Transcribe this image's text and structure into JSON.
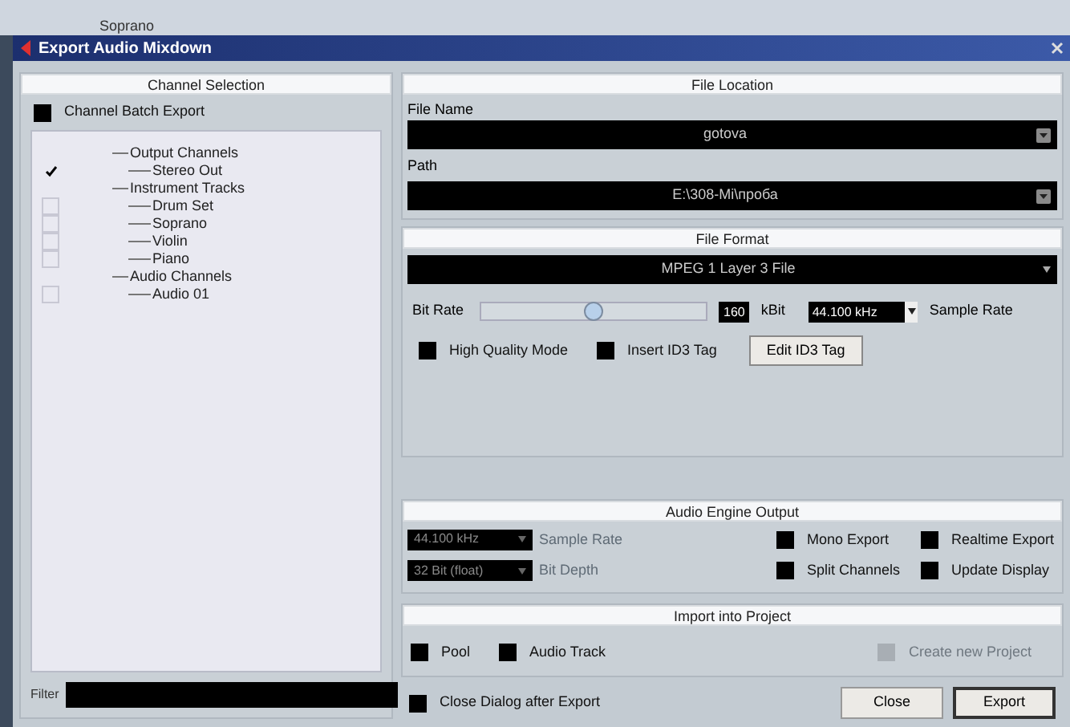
{
  "background_track": "Soprano",
  "window": {
    "title": "Export Audio Mixdown"
  },
  "channel_selection": {
    "title": "Channel Selection",
    "batch_export": {
      "label": "Channel Batch Export",
      "checked": false
    },
    "tree": [
      {
        "label": "Output Channels",
        "children": [
          {
            "label": "Stereo Out",
            "checked": true
          }
        ]
      },
      {
        "label": "Instrument Tracks",
        "children": [
          {
            "label": "Drum Set",
            "checked": false
          },
          {
            "label": "Soprano",
            "checked": false
          },
          {
            "label": "Violin",
            "checked": false
          },
          {
            "label": "Piano",
            "checked": false
          }
        ]
      },
      {
        "label": "Audio Channels",
        "children": [
          {
            "label": "Audio 01",
            "checked": false
          }
        ]
      }
    ],
    "filter": {
      "label": "Filter"
    }
  },
  "file_location": {
    "title": "File Location",
    "file_name_label": "File Name",
    "file_name": "gotova",
    "path_label": "Path",
    "path": "E:\\308-Mi\\проба"
  },
  "file_format": {
    "title": "File Format",
    "format": "MPEG 1 Layer 3 File",
    "bit_rate_label": "Bit Rate",
    "bit_rate": {
      "level": 0.5
    },
    "bit_rate_value": "160",
    "bit_rate_unit": "kBit",
    "sample_rate": "44.100 kHz",
    "sample_rate_label": "Sample Rate",
    "options": [
      {
        "label": "High Quality Mode",
        "checked": false
      },
      {
        "label": "Insert ID3 Tag",
        "checked": false
      }
    ],
    "edit_button": "Edit ID3 Tag"
  },
  "audio_engine_output": {
    "title": "Audio Engine Output",
    "sample_rate": {
      "value": "44.100 kHz",
      "label": "Sample Rate",
      "disabled": true
    },
    "bit_depth": {
      "value": "32 Bit (float)",
      "label": "Bit Depth",
      "disabled": true
    },
    "options": [
      {
        "label": "Mono Export",
        "checked": false
      },
      {
        "label": "Realtime Export",
        "checked": false
      },
      {
        "label": "Split Channels",
        "checked": false
      },
      {
        "label": "Update Display",
        "checked": false
      }
    ]
  },
  "import_into_project": {
    "title": "Import into Project",
    "options": [
      {
        "label": "Pool",
        "checked": false,
        "disabled": false
      },
      {
        "label": "Audio Track",
        "checked": false,
        "disabled": false
      },
      {
        "label": "Create new Project",
        "checked": false,
        "disabled": true
      }
    ]
  },
  "close_after_export": {
    "label": "Close Dialog after Export",
    "checked": false
  },
  "buttons": [
    {
      "label": "Close",
      "kind": "plain"
    },
    {
      "label": "Export",
      "kind": "default"
    }
  ]
}
